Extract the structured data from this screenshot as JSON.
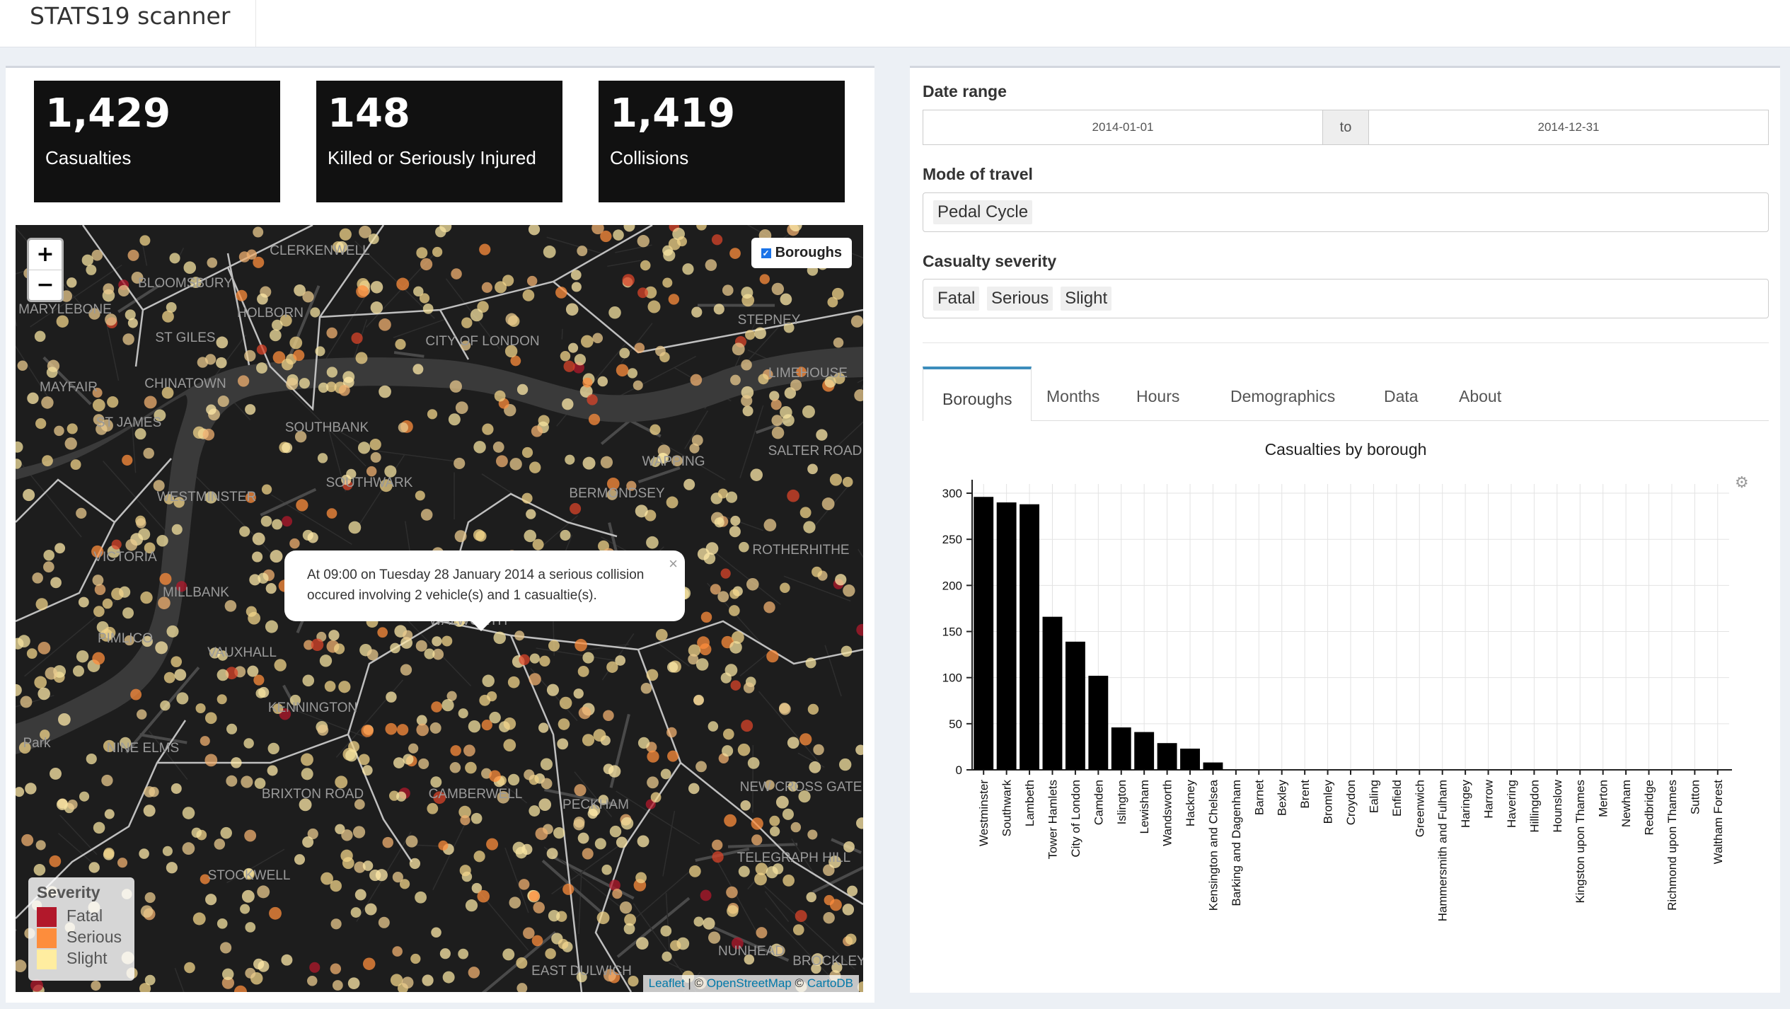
{
  "app": {
    "title": "STATS19 scanner"
  },
  "value_boxes": [
    {
      "value": "1,429",
      "label": "Casualties"
    },
    {
      "value": "148",
      "label": "Killed or Seriously Injured"
    },
    {
      "value": "1,419",
      "label": "Collisions"
    }
  ],
  "map": {
    "zoom_in": "+",
    "zoom_out": "−",
    "layer_control": {
      "label": "Boroughs",
      "checked": true
    },
    "popup": {
      "text": "At 09:00 on Tuesday 28 January 2014 a serious collision occured involving 2 vehicle(s) and 1 casualtie(s).",
      "close": "×"
    },
    "place_labels": [
      "CLERKENWELL",
      "BLOOMSBURY",
      "MARYLEBONE",
      "HOLBORN",
      "ST GILES",
      "CITY OF LONDON",
      "STEPNEY",
      "MAYFAIR",
      "CHINATOWN",
      "LIMEHOUSE",
      "ST JAMES",
      "SOUTHBANK",
      "WAPPING",
      "SALTER ROAD",
      "WESTMINSTER",
      "SOUTHWARK",
      "BERMONDSEY",
      "ROTHERHITHE",
      "VICTORIA",
      "MILLBANK",
      "WALWORTH",
      "PIMLICO",
      "VAUXHALL",
      "KENNINGTON",
      "Park",
      "NINE ELMS",
      "NEW CROSS GATE",
      "CAMBERWELL",
      "PECKHAM",
      "TELEGRAPH HILL",
      "STOCKWELL",
      "BRIXTON ROAD",
      "NUNHEAD",
      "EAST DULWICH",
      "BROCKLEY"
    ],
    "legend": {
      "title": "Severity",
      "items": [
        {
          "label": "Fatal",
          "color": "#b2182b"
        },
        {
          "label": "Serious",
          "color": "#fd8d3c"
        },
        {
          "label": "Slight",
          "color": "#ffeda0"
        }
      ]
    },
    "attribution": {
      "leaflet": "Leaflet",
      "sep1": " | © ",
      "osm": "OpenStreetMap",
      "sep2": " © ",
      "carto": "CartoDB"
    },
    "colors": {
      "background": "#1d1d1d",
      "river": "#3a3a3a",
      "boroughs": "#bfbfbf"
    }
  },
  "filters": {
    "date_range": {
      "label": "Date range",
      "start": "2014-01-01",
      "separator": "to",
      "end": "2014-12-31"
    },
    "mode": {
      "label": "Mode of travel",
      "selected": [
        "Pedal Cycle"
      ]
    },
    "severity": {
      "label": "Casualty severity",
      "selected": [
        "Fatal",
        "Serious",
        "Slight"
      ]
    }
  },
  "tabs": [
    "Boroughs",
    "Months",
    "Hours",
    "Demographics",
    "Data",
    "About"
  ],
  "active_tab": "Boroughs",
  "chart_data": {
    "type": "bar",
    "title": "Casualties by borough",
    "categories": [
      "Westminster",
      "Southwark",
      "Lambeth",
      "Tower Hamlets",
      "City of London",
      "Camden",
      "Islington",
      "Lewisham",
      "Wandsworth",
      "Hackney",
      "Kensington and Chelsea",
      "Barking and Dagenham",
      "Barnet",
      "Bexley",
      "Brent",
      "Bromley",
      "Croydon",
      "Ealing",
      "Enfield",
      "Greenwich",
      "Hammersmith and Fulham",
      "Haringey",
      "Harrow",
      "Havering",
      "Hillingdon",
      "Hounslow",
      "Kingston upon Thames",
      "Merton",
      "Newham",
      "Redbridge",
      "Richmond upon Thames",
      "Sutton",
      "Waltham Forest"
    ],
    "values": [
      296,
      290,
      288,
      166,
      139,
      102,
      46,
      41,
      29,
      23,
      8,
      0,
      0,
      0,
      0,
      0,
      0,
      0,
      0,
      0,
      0,
      0,
      0,
      0,
      0,
      0,
      0,
      0,
      0,
      0,
      0,
      0,
      0
    ],
    "ylim": [
      0,
      310
    ],
    "yticks": [
      0,
      50,
      100,
      150,
      200,
      250,
      300
    ],
    "xlabel": "",
    "ylabel": "",
    "grid": true,
    "bar_color": "#000000"
  }
}
